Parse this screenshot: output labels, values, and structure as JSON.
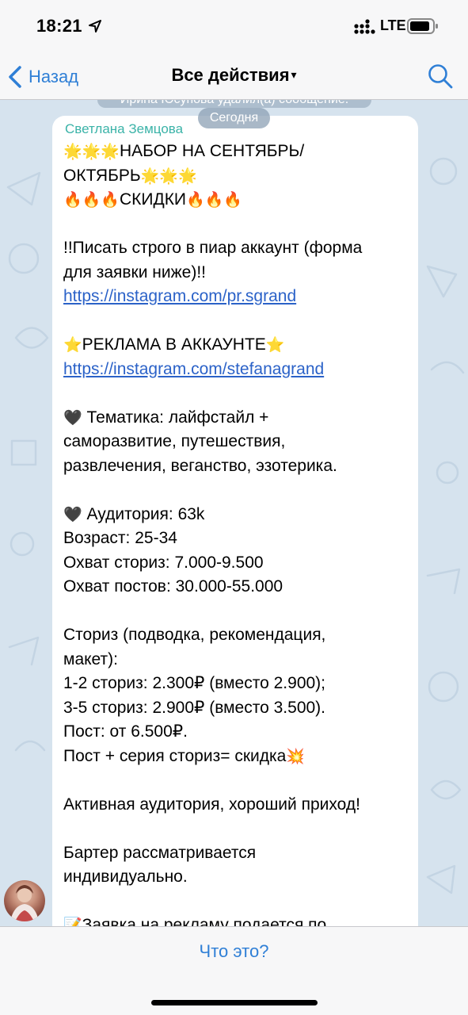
{
  "status_bar": {
    "time": "18:21",
    "network": "LTE"
  },
  "nav": {
    "back_label": "Назад",
    "title": "Все действия",
    "title_caret": "▾"
  },
  "chat": {
    "service_message": "Ирина Юсупова удалил(а) сообщение.",
    "date_chip": "Сегодня",
    "message": {
      "sender": "Светлана Земцова",
      "lines": [
        {
          "pre": "🌟🌟🌟",
          "text": "НАБОР НА СЕНТЯБРЬ/",
          "post": ""
        },
        {
          "pre": "",
          "text": "ОКТЯБРЬ",
          "post": "🌟🌟🌟"
        },
        {
          "pre": "🔥🔥🔥",
          "text": "СКИДКИ",
          "post": "🔥🔥🔥"
        },
        {
          "pre": "",
          "text": "",
          "post": ""
        },
        {
          "pre": "",
          "text": "!!Писать строго в пиар аккаунт (форма",
          "post": ""
        },
        {
          "pre": "",
          "text": "для заявки ниже)!!",
          "post": ""
        },
        {
          "pre": "",
          "link": "https://instagram.com/pr.sgrand",
          "post": ""
        },
        {
          "pre": "",
          "text": "",
          "post": ""
        },
        {
          "pre": "⭐",
          "text": "РЕКЛАМА В АККАУНТЕ",
          "post": "⭐"
        },
        {
          "pre": "",
          "link": "https://instagram.com/stefanagrand",
          "post": ""
        },
        {
          "pre": "",
          "text": "",
          "post": ""
        },
        {
          "pre": "🖤",
          "text": "  Тематика: лайфстайл +",
          "post": ""
        },
        {
          "pre": "",
          "text": "саморазвитие, путешествия,",
          "post": ""
        },
        {
          "pre": "",
          "text": "развлечения, веганство, эзотерика.",
          "post": ""
        },
        {
          "pre": "",
          "text": "",
          "post": ""
        },
        {
          "pre": "🖤",
          "text": "  Аудитория: 63k",
          "post": ""
        },
        {
          "pre": "",
          "text": "Возраст: 25-34",
          "post": ""
        },
        {
          "pre": "",
          "text": "Охват сториз: 7.000-9.500",
          "post": ""
        },
        {
          "pre": "",
          "text": "Охват постов: 30.000-55.000",
          "post": ""
        },
        {
          "pre": "",
          "text": "",
          "post": ""
        },
        {
          "pre": "",
          "text": "Сториз (подводка, рекомендация,",
          "post": ""
        },
        {
          "pre": "",
          "text": "макет):",
          "post": ""
        },
        {
          "pre": "",
          "text": "1-2 сториз: 2.300₽ (вместо 2.900);",
          "post": ""
        },
        {
          "pre": "",
          "text": "3-5 сториз: 2.900₽ (вместо 3.500).",
          "post": ""
        },
        {
          "pre": "",
          "text": "Пост: от 6.500₽.",
          "post": ""
        },
        {
          "pre": "",
          "text": "Пост + серия сториз= скидка",
          "post": "💥"
        },
        {
          "pre": "",
          "text": "",
          "post": ""
        },
        {
          "pre": "",
          "text": "Активная аудитория, хороший приход!",
          "post": ""
        },
        {
          "pre": "",
          "text": "",
          "post": ""
        },
        {
          "pre": "",
          "text": "Бартер рассматривается",
          "post": ""
        },
        {
          "pre": "",
          "text": "индивидуально.",
          "post": ""
        },
        {
          "pre": "",
          "text": "",
          "post": ""
        },
        {
          "pre": "📝",
          "text": "Заявка на рекламу подается по",
          "post": ""
        }
      ]
    }
  },
  "bottom": {
    "action_label": "Что это?"
  },
  "colors": {
    "accent": "#2f7fd6",
    "sender_name": "#3bb3a8",
    "link": "#2b62c8",
    "chat_background": "#d6e3ee"
  },
  "icons": {
    "back": "chevron-left-icon",
    "search": "search-icon",
    "location": "location-arrow-icon",
    "signal": "signal-icon",
    "battery": "battery-icon"
  }
}
